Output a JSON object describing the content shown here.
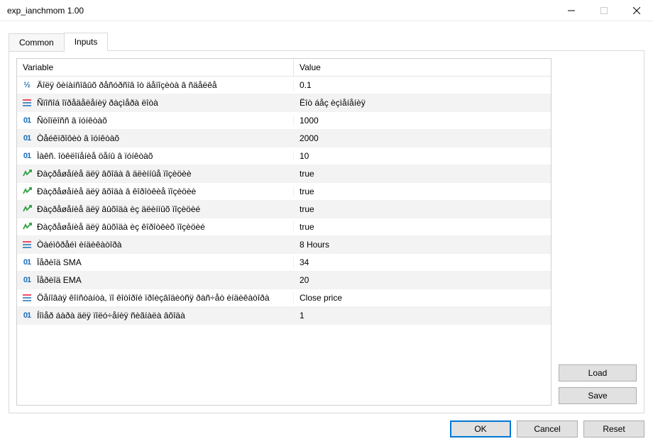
{
  "window": {
    "title": "exp_ianchmom 1.00"
  },
  "tabs": {
    "common": "Common",
    "inputs": "Inputs"
  },
  "table": {
    "headers": {
      "variable": "Variable",
      "value": "Value"
    },
    "rows": [
      {
        "icon": "fraction",
        "name": "Äîëÿ ôèíàíñîâûõ ðåñóðñîâ îò äåïîçèòà â ñäåëêå",
        "value": "0.1"
      },
      {
        "icon": "string",
        "name": "Ñïîñîá îïðåäåëåíèÿ ðàçìåðà ëîòà",
        "value": "Ëîò áåç èçìåíåíèÿ"
      },
      {
        "icon": "int",
        "name": "Ñòîïëîññ â ïóíêòàõ",
        "value": "1000"
      },
      {
        "icon": "int",
        "name": "Òåéêïðîôèò â ïóíêòàõ",
        "value": "2000"
      },
      {
        "icon": "int",
        "name": "Ìàêñ. îòêëîíåíèå öåíû â ïóíêòàõ",
        "value": "10"
      },
      {
        "icon": "bool",
        "name": "Ðàçðåøåíèå äëÿ âõîäà â äëèííûå ïîçèöèè",
        "value": "true"
      },
      {
        "icon": "bool",
        "name": "Ðàçðåøåíèå äëÿ âõîäà â êîðîòêèå ïîçèöèè",
        "value": "true"
      },
      {
        "icon": "bool",
        "name": "Ðàçðåøåíèå äëÿ âûõîäà èç äëèííûõ ïîçèöèé",
        "value": "true"
      },
      {
        "icon": "bool",
        "name": "Ðàçðåøåíèå äëÿ âûõîäà èç êîðîòêèõ ïîçèöèé",
        "value": "true"
      },
      {
        "icon": "string",
        "name": "Òàéìôðåéì èíäèêàòîðà",
        "value": "8 Hours"
      },
      {
        "icon": "int",
        "name": "Ïåðèîä SMA",
        "value": "34"
      },
      {
        "icon": "int",
        "name": "Ïåðèîä EMA",
        "value": "20"
      },
      {
        "icon": "string",
        "name": "Öåíîâàÿ êîíñòàíòà, ïî êîòîðîé ïðîèçâîäèòñÿ ðàñ÷åò èíäèêàòîðà",
        "value": "Close price"
      },
      {
        "icon": "int",
        "name": "Íîìåð áàðà äëÿ ïîëó÷åíèÿ ñèãíàëà âõîäà",
        "value": "1"
      }
    ]
  },
  "buttons": {
    "load": "Load",
    "save": "Save",
    "ok": "OK",
    "cancel": "Cancel",
    "reset": "Reset"
  }
}
